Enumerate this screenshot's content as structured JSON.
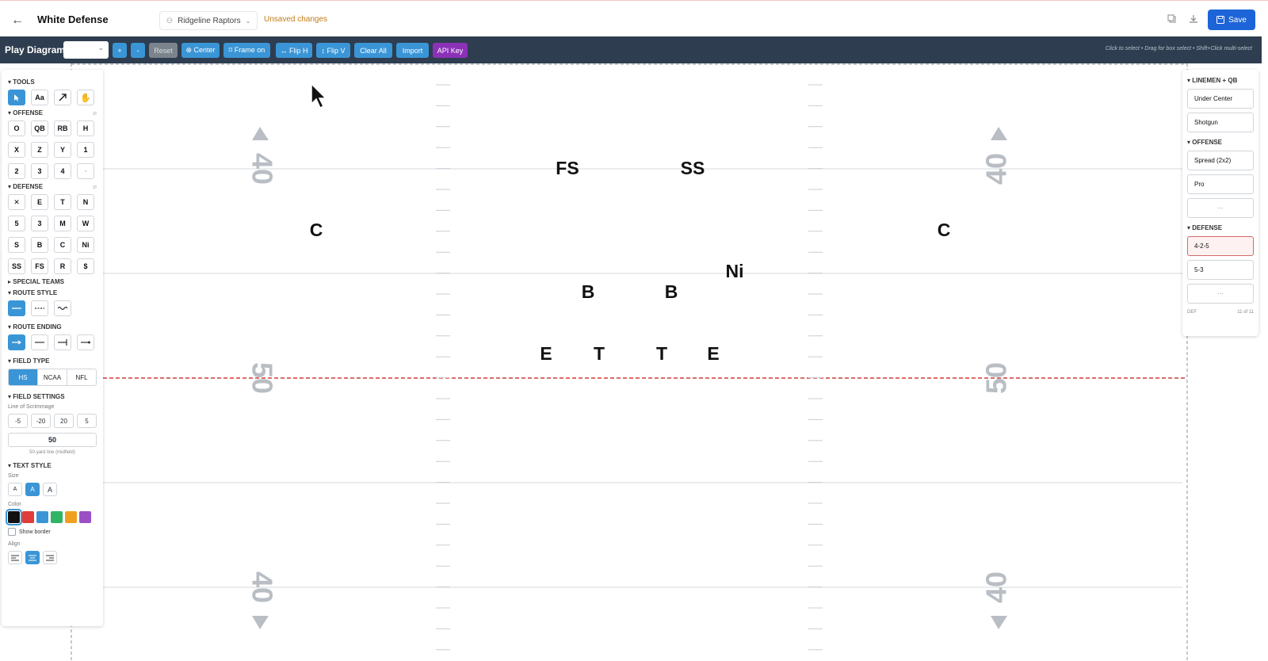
{
  "header": {
    "back_icon": "arrow-left-icon",
    "title": "White Defense",
    "team_label": "Ridgeline Raptors",
    "unsaved": "Unsaved changes",
    "save_label": "Save"
  },
  "toolbar": {
    "label": "Play Diagram",
    "select_value": "",
    "buttons": {
      "zoom_in": "+",
      "zoom_out": "-",
      "reset": "Reset",
      "center": "⊕ Center",
      "frame": "⌑ Frame on",
      "flip_h": "↔ Flip H",
      "flip_v": "↕ Flip V",
      "clear": "Clear All",
      "import": "Import",
      "api": "API Key"
    },
    "hint": "Click to select • Drag for box select • Shift+Click multi-select"
  },
  "left_panel": {
    "tools_title": "▾ TOOLS",
    "tools": [
      "select-pointer-icon",
      "Aa",
      "arrow-route-icon",
      "hand-pan-icon"
    ],
    "offense_title": "▾ OFFENSE",
    "offense": [
      "O",
      "QB",
      "RB",
      "H",
      "X",
      "Z",
      "Y",
      "1",
      "2",
      "3",
      "4",
      "▫"
    ],
    "defense_title": "▾ DEFENSE",
    "defense": [
      "✕",
      "E",
      "T",
      "N",
      "5",
      "3",
      "M",
      "W",
      "S",
      "B",
      "C",
      "Ni",
      "SS",
      "FS",
      "R",
      "$"
    ],
    "special_title": "▸ SPECIAL TEAMS",
    "route_style_title": "▾ ROUTE STYLE",
    "route_ending_title": "▾ ROUTE ENDING",
    "field_type_title": "▾ FIELD TYPE",
    "field_types": [
      "HS",
      "NCAA",
      "NFL"
    ],
    "field_settings_title": "▾ FIELD SETTINGS",
    "los_label": "Line of Scrimmage",
    "los_buttons": [
      "-5",
      "-20",
      "20",
      "5"
    ],
    "los_value": "50",
    "los_note": "50-yard line (midfield)",
    "text_style_title": "▾ TEXT STYLE",
    "size_label": "Size",
    "sizes": [
      "A",
      "A",
      "A"
    ],
    "color_label": "Color",
    "colors": [
      "#111111",
      "#e03c3c",
      "#3a95d6",
      "#2fb564",
      "#f0a020",
      "#9b4fc4"
    ],
    "show_border": "Show border",
    "align_label": "Align"
  },
  "right_panel": {
    "linemen_title": "▾ LINEMEN + QB",
    "linemen": [
      "Under Center",
      "Shotgun"
    ],
    "offense_title": "▾ OFFENSE",
    "offense": [
      "Spread (2x2)",
      "Pro",
      "···"
    ],
    "defense_title": "▾ DEFENSE",
    "defense": [
      "4-2-5",
      "5-3",
      "···"
    ],
    "footer_left": "DEF",
    "footer_right": "11 of 11"
  },
  "field": {
    "numbers": {
      "top": "40",
      "mid": "50",
      "bottom": "40"
    },
    "players": [
      {
        "label": "FS"
      },
      {
        "label": "SS"
      },
      {
        "label": "C"
      },
      {
        "label": "C"
      },
      {
        "label": "Ni"
      },
      {
        "label": "B"
      },
      {
        "label": "B"
      },
      {
        "label": "E"
      },
      {
        "label": "T"
      },
      {
        "label": "T"
      },
      {
        "label": "E"
      }
    ]
  },
  "colors": {
    "accent": "#3a95d6",
    "toolbar_bg": "#2e3d4f",
    "save": "#1d64d8",
    "api_key": "#8b31b8",
    "los_line": "#d13b3b"
  }
}
